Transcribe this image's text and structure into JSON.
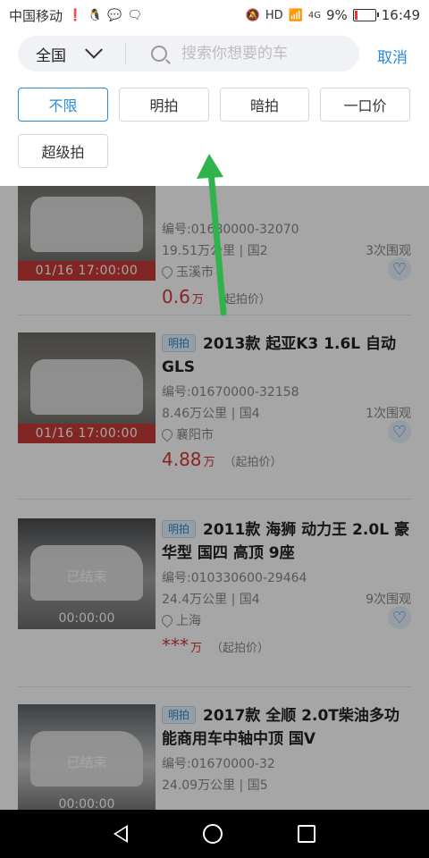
{
  "status_bar": {
    "carrier": "中国移动",
    "network": "4G",
    "battery": "9%",
    "time": "16:49"
  },
  "search": {
    "region": "全国",
    "placeholder": "搜索你想要的车",
    "cancel": "取消"
  },
  "filters": [
    "不限",
    "明拍",
    "暗拍",
    "一口价",
    "超级拍"
  ],
  "active_filter": "不限",
  "listings": [
    {
      "title": "",
      "code": "编号:01680000-32070",
      "mileage": "19.51万公里 | 国2",
      "views": "3次围观",
      "location": "玉溪市",
      "price": "0.6",
      "price_unit": "万",
      "price_label": "（起拍价）",
      "time": "01/16 17:00:00"
    },
    {
      "tag": "明拍",
      "title": "2013款 起亚K3 1.6L 自动 GLS",
      "code": "编号:01670000-32158",
      "mileage": "8.46万公里 | 国4",
      "views": "1次围观",
      "location": "襄阳市",
      "price": "4.88",
      "price_unit": "万",
      "price_label": "（起拍价）",
      "time": "01/16 17:00:00"
    },
    {
      "tag": "明拍",
      "title": "2011款 海狮 动力王 2.0L 豪华型 国四 高顶 9座",
      "code": "编号:010330600-29464",
      "mileage": "24.4万公里 | 国4",
      "views": "9次围观",
      "location": "上海",
      "price": "***",
      "price_unit": "万",
      "price_label": "（起拍价）",
      "ended": "已结束",
      "time": "00:00:00"
    },
    {
      "tag": "明拍",
      "title": "2017款 全顺 2.0T柴油多功能商用车中轴中顶 国V",
      "code": "编号:01670000-32",
      "mileage": "24.09万公里 | 国5",
      "ended": "已结束",
      "time": "00:00:00"
    }
  ],
  "colors": {
    "accent": "#2a8bd8",
    "price": "#d2383a",
    "ribbon": "#c73a3a",
    "arrow": "#2fb34a"
  }
}
